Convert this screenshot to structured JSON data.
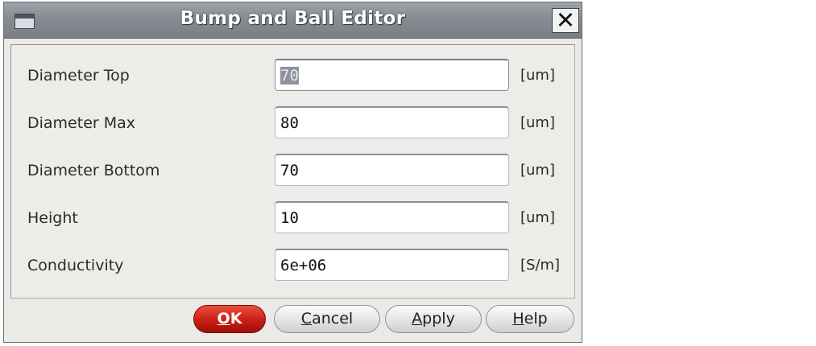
{
  "window": {
    "title": "Bump and Ball Editor",
    "close_glyph": "✕"
  },
  "fields": [
    {
      "label": "Diameter Top",
      "value": "70",
      "unit": "[um]",
      "focused": true,
      "selected": true
    },
    {
      "label": "Diameter Max",
      "value": "80",
      "unit": "[um]"
    },
    {
      "label": "Diameter Bottom",
      "value": "70",
      "unit": "[um]"
    },
    {
      "label": "Height",
      "value": "10",
      "unit": "[um]"
    },
    {
      "label": "Conductivity",
      "value": "6e+06",
      "unit": "[S/m]"
    }
  ],
  "buttons": {
    "ok": {
      "mnemonic": "O",
      "rest": "K"
    },
    "cancel": {
      "mnemonic": "C",
      "rest": "ancel"
    },
    "apply": {
      "mnemonic": "A",
      "rest": "pply"
    },
    "help": {
      "mnemonic": "H",
      "rest": "elp"
    }
  },
  "colors": {
    "titlebar": "#878c93",
    "ok_button": "#c91f14",
    "selection": "#8d939c",
    "dialog_bg": "#eceae6"
  }
}
